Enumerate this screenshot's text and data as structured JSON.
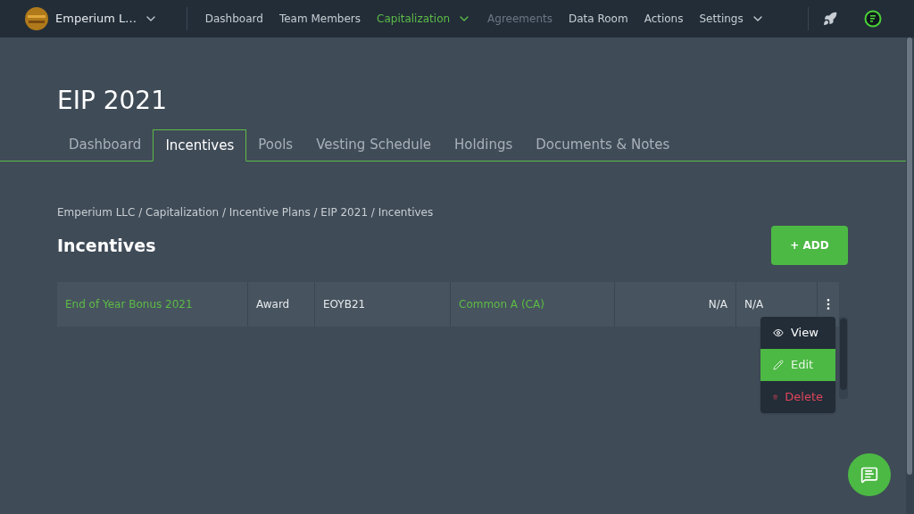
{
  "topbar": {
    "company": "Emperium L...",
    "nav": [
      {
        "label": "Dashboard",
        "selected": false,
        "disabled": false,
        "dropdown": false
      },
      {
        "label": "Team Members",
        "selected": false,
        "disabled": false,
        "dropdown": false
      },
      {
        "label": "Capitalization",
        "selected": true,
        "disabled": false,
        "dropdown": true
      },
      {
        "label": "Agreements",
        "selected": false,
        "disabled": true,
        "dropdown": false
      },
      {
        "label": "Data Room",
        "selected": false,
        "disabled": false,
        "dropdown": false
      },
      {
        "label": "Actions",
        "selected": false,
        "disabled": false,
        "dropdown": false
      },
      {
        "label": "Settings",
        "selected": false,
        "disabled": false,
        "dropdown": true
      }
    ]
  },
  "page_title": "EIP 2021",
  "tabs": [
    {
      "label": "Dashboard",
      "selected": false
    },
    {
      "label": "Incentives",
      "selected": true
    },
    {
      "label": "Pools",
      "selected": false
    },
    {
      "label": "Vesting Schedule",
      "selected": false
    },
    {
      "label": "Holdings",
      "selected": false
    },
    {
      "label": "Documents & Notes",
      "selected": false
    }
  ],
  "breadcrumb": "Emperium LLC / Capitalization / Incentive Plans / EIP 2021 / Incentives",
  "section_title": "Incentives",
  "add_button": "+ ADD",
  "table": {
    "rows": [
      {
        "cells": [
          {
            "text": "End of Year Bonus 2021",
            "kind": "link"
          },
          {
            "text": "Award",
            "kind": "text"
          },
          {
            "text": "EOYB21",
            "kind": "text"
          },
          {
            "text": "Common A (CA)",
            "kind": "link"
          },
          {
            "text": "N/A",
            "kind": "number"
          },
          {
            "text": "N/A",
            "kind": "text"
          }
        ]
      }
    ]
  },
  "row_menu": [
    {
      "label": "View",
      "kind": "view",
      "selected": false
    },
    {
      "label": "Edit",
      "kind": "edit",
      "selected": true
    },
    {
      "label": "Delete",
      "kind": "delete",
      "selected": false
    }
  ]
}
